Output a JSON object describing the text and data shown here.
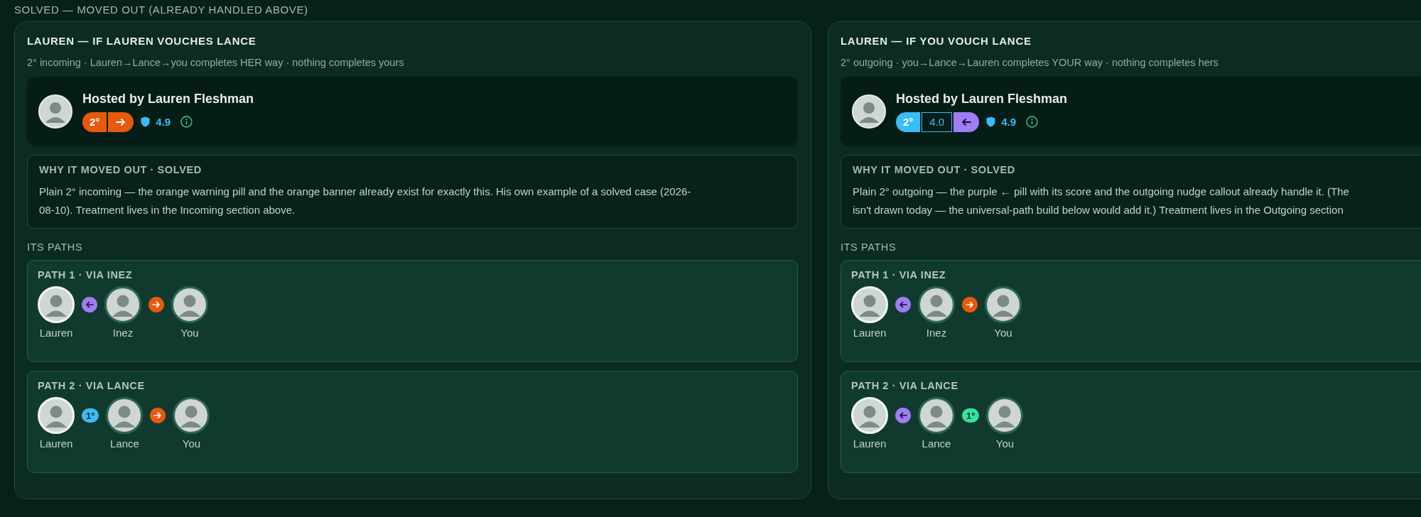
{
  "section_title": "SOLVED — MOVED OUT (ALREADY HANDLED ABOVE)",
  "cards": [
    {
      "title": "LAUREN — IF LAUREN VOUCHES LANCE",
      "subtitle": "2° incoming · Lauren→Lance→you completes HER way · nothing completes yours",
      "host": {
        "name": "Hosted by Lauren Fleshman",
        "badges": [
          {
            "kind": "degree",
            "label": "2°",
            "color": "#e8590c"
          },
          {
            "kind": "arrow-right",
            "color": "#e8590c"
          }
        ],
        "rating": "4.9"
      },
      "why": {
        "heading": "WHY IT MOVED OUT · SOLVED",
        "lines": [
          "Plain 2° incoming — the orange warning pill and the orange banner already exist for exactly this. His own example of a solved case (2026-",
          "08-10). Treatment lives in the Incoming section above."
        ]
      },
      "paths_heading": "ITS PATHS",
      "paths": [
        {
          "title": "PATH 1 · VIA INEZ",
          "steps": [
            {
              "kind": "person",
              "name": "Lauren",
              "host": true
            },
            {
              "kind": "arrow-left",
              "color": "#a07cf5"
            },
            {
              "kind": "person",
              "name": "Inez",
              "host": false
            },
            {
              "kind": "arrow-right",
              "color": "#e8590c"
            },
            {
              "kind": "person",
              "name": "You",
              "host": false
            }
          ]
        },
        {
          "title": "PATH 2 · VIA LANCE",
          "steps": [
            {
              "kind": "person",
              "name": "Lauren",
              "host": true
            },
            {
              "kind": "degree",
              "label": "1°",
              "color": "#38bdf8"
            },
            {
              "kind": "person",
              "name": "Lance",
              "host": false
            },
            {
              "kind": "arrow-right",
              "color": "#e8590c"
            },
            {
              "kind": "person",
              "name": "You",
              "host": false
            }
          ]
        }
      ]
    },
    {
      "title": "LAUREN — IF YOU VOUCH LANCE",
      "subtitle": "2° outgoing · you→Lance→Lauren completes YOUR way · nothing completes hers",
      "host": {
        "name": "Hosted by Lauren Fleshman",
        "badges": [
          {
            "kind": "degree",
            "label": "2°",
            "color": "#38bdf8"
          },
          {
            "kind": "score",
            "label": "4.0",
            "color": "#38bdf8"
          },
          {
            "kind": "arrow-left",
            "color": "#a07cf5"
          }
        ],
        "rating": "4.9"
      },
      "why": {
        "heading": "WHY IT MOVED OUT · SOLVED",
        "lines": [
          "Plain 2° outgoing — the purple ← pill with its score and the outgoing nudge callout already handle it. (The",
          "isn't drawn today — the universal-path build below would add it.) Treatment lives in the Outgoing section"
        ]
      },
      "paths_heading": "ITS PATHS",
      "paths": [
        {
          "title": "PATH 1 · VIA INEZ",
          "steps": [
            {
              "kind": "person",
              "name": "Lauren",
              "host": true
            },
            {
              "kind": "arrow-left",
              "color": "#a07cf5"
            },
            {
              "kind": "person",
              "name": "Inez",
              "host": false
            },
            {
              "kind": "arrow-right",
              "color": "#e8590c"
            },
            {
              "kind": "person",
              "name": "You",
              "host": false
            }
          ]
        },
        {
          "title": "PATH 2 · VIA LANCE",
          "steps": [
            {
              "kind": "person",
              "name": "Lauren",
              "host": true
            },
            {
              "kind": "arrow-left",
              "color": "#a07cf5"
            },
            {
              "kind": "person",
              "name": "Lance",
              "host": false
            },
            {
              "kind": "degree",
              "label": "1°",
              "color": "#2ee6a0"
            },
            {
              "kind": "person",
              "name": "You",
              "host": false
            }
          ]
        }
      ]
    }
  ]
}
